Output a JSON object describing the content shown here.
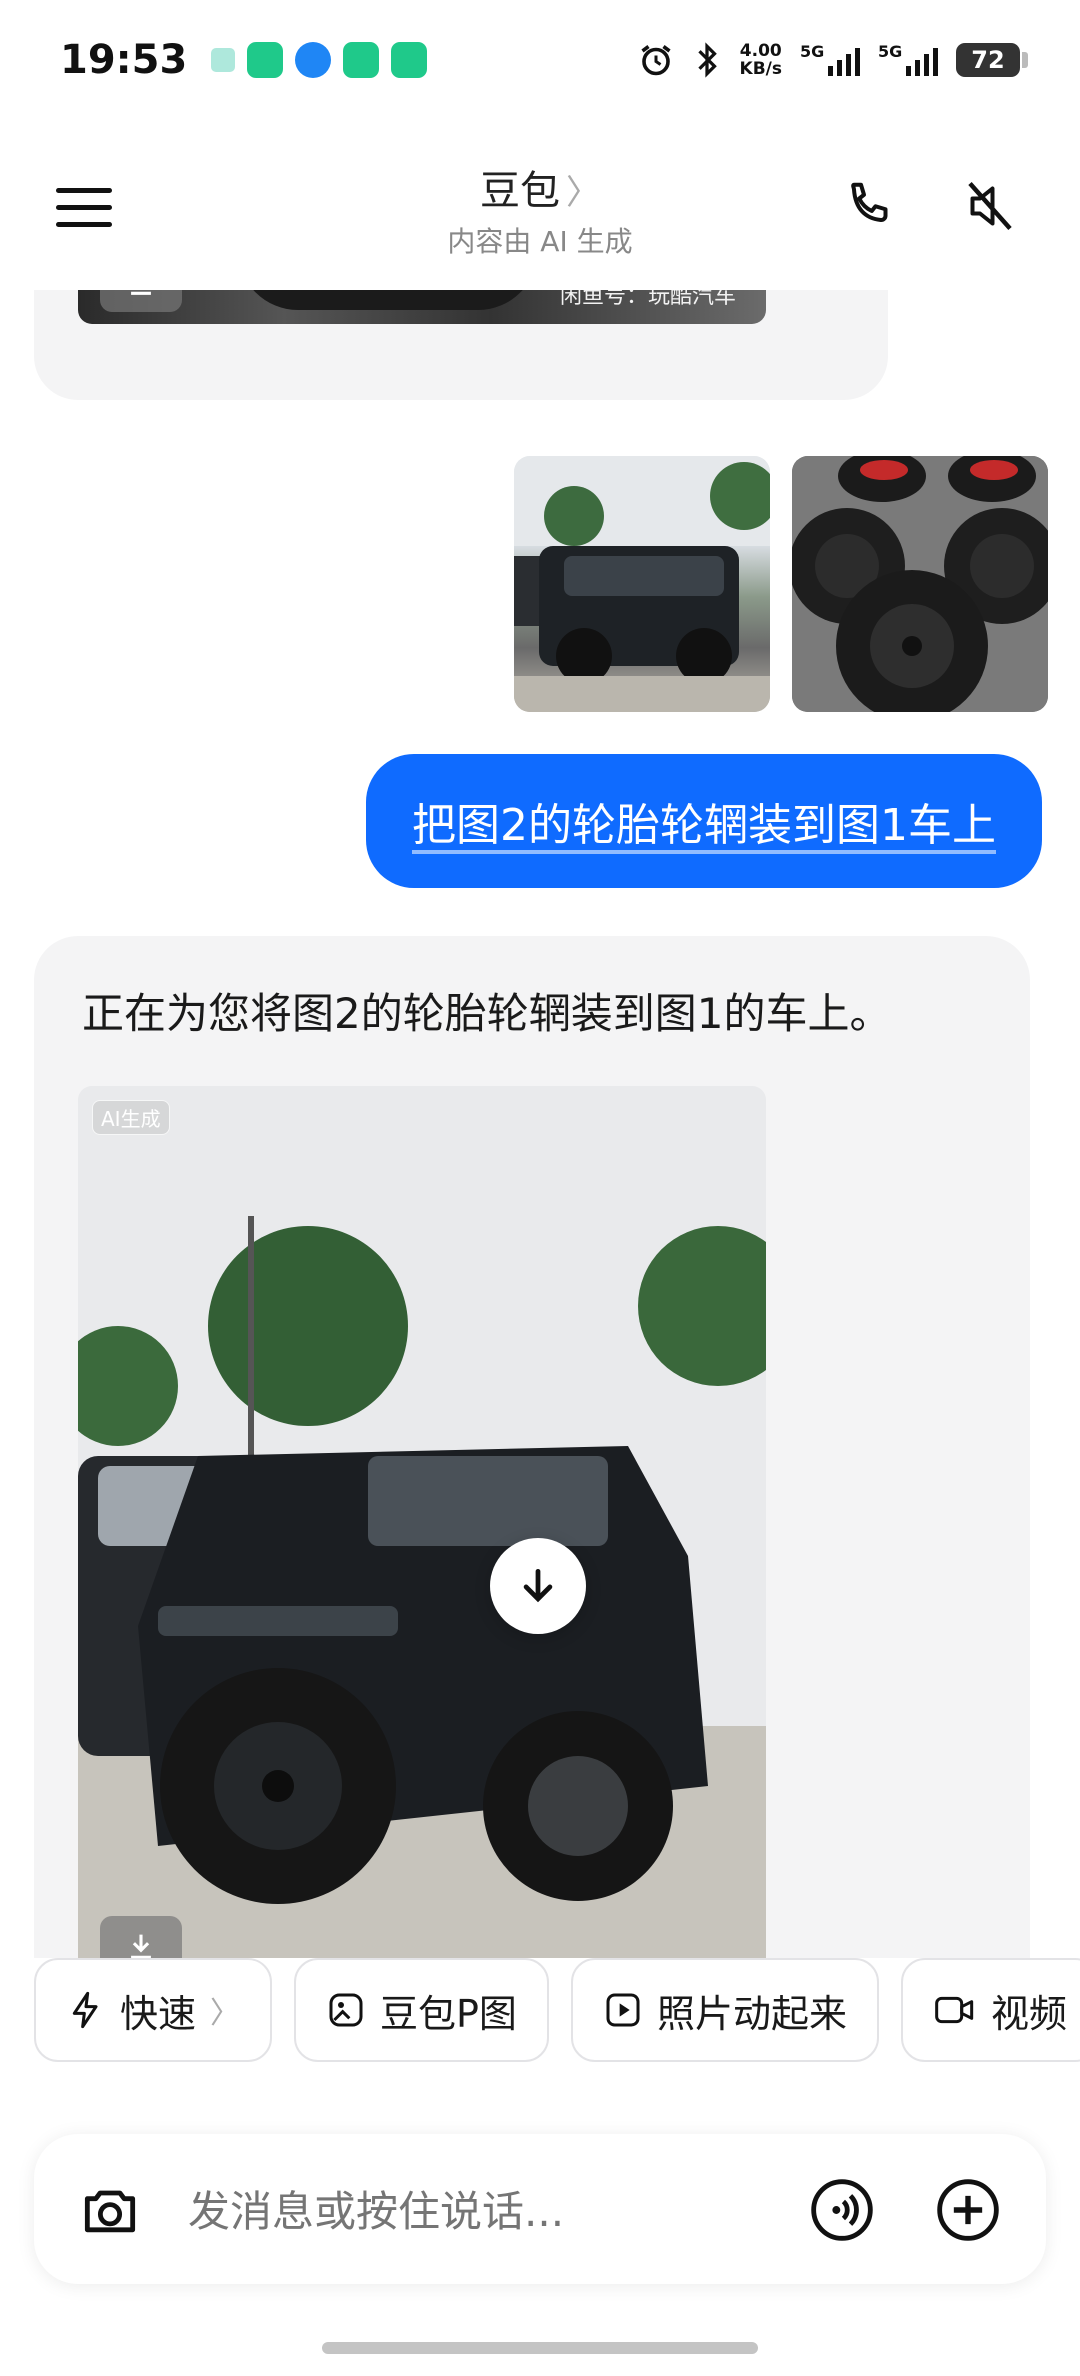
{
  "status_bar": {
    "time": "19:53",
    "net_speed_value": "4.00",
    "net_speed_unit": "KB/s",
    "signal1_label": "5G",
    "signal2_label": "5G",
    "battery": "72"
  },
  "header": {
    "title": "豆包",
    "title_chevron": "〉",
    "subtitle": "内容由 AI 生成"
  },
  "chat": {
    "previous_image_watermark": "闲鱼号：玩酷汽车",
    "user_message": "把图2的轮胎轮辋装到图1车上",
    "bot_message": "正在为您将图2的轮胎轮辋装到图1的车上。",
    "generated_image_tag": "AI生成"
  },
  "actions": [
    {
      "label": "快速",
      "icon": "lightning-icon",
      "chevron": "〉"
    },
    {
      "label": "豆包P图",
      "icon": "image-edit-icon"
    },
    {
      "label": "照片动起来",
      "icon": "play-icon"
    },
    {
      "label": "视频",
      "icon": "video-camera-icon"
    }
  ],
  "input": {
    "placeholder": "发消息或按住说话..."
  },
  "colors": {
    "accent": "#0f6bff",
    "bubble_bg": "#f4f4f5"
  }
}
